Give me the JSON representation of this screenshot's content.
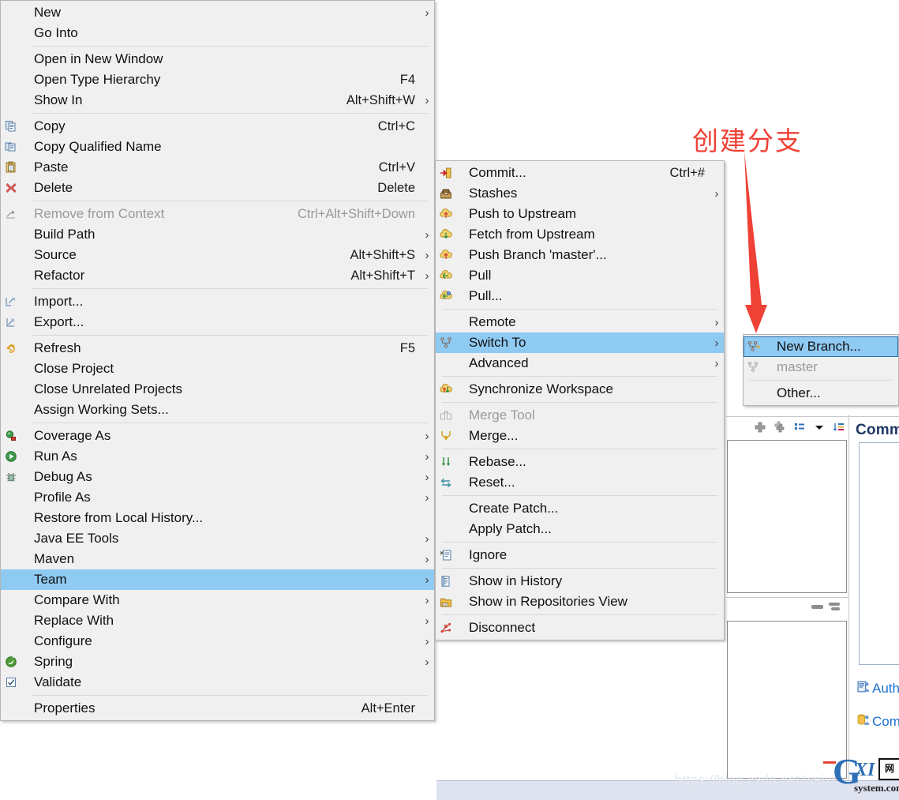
{
  "annotation": {
    "text": "创建分支",
    "color": "#ef4136",
    "arrow": "down-arrow"
  },
  "watermark": {
    "url": "https://blog.csdn.net/weixi",
    "logo_main": "G",
    "logo_xi": "XI",
    "logo_cn": "网",
    "logo_sub": "system.com"
  },
  "ide": {
    "commit_section_title": "Comm",
    "meta": [
      {
        "icon": "author-icon",
        "label": "Auth"
      },
      {
        "icon": "committer-icon",
        "label": "Com"
      }
    ],
    "toolbar_icons": [
      "add-icon",
      "add-all-icon",
      "list-view-icon",
      "chevron-down-icon",
      "sort-icon"
    ]
  },
  "colors": {
    "menu_bg": "#f0f0f0",
    "menu_border": "#b4b4b4",
    "highlight": "#8fcaf3",
    "highlight_border": "#2a6fa8",
    "separator": "#d8d8d8",
    "disabled_text": "#9a9a9a",
    "accent_red": "#ef4136",
    "link_blue": "#1d6fd0"
  },
  "context_menu": {
    "name": "project-context-menu",
    "items": [
      {
        "label": "New",
        "accel": "",
        "submenu": true,
        "icon": "",
        "type": "item"
      },
      {
        "label": "Go Into",
        "accel": "",
        "submenu": false,
        "icon": "",
        "type": "item"
      },
      {
        "type": "separator"
      },
      {
        "label": "Open in New Window",
        "accel": "",
        "submenu": false,
        "icon": "",
        "type": "item"
      },
      {
        "label": "Open Type Hierarchy",
        "accel": "F4",
        "submenu": false,
        "icon": "",
        "type": "item"
      },
      {
        "label": "Show In",
        "accel": "Alt+Shift+W",
        "submenu": true,
        "icon": "",
        "type": "item"
      },
      {
        "type": "separator"
      },
      {
        "label": "Copy",
        "accel": "Ctrl+C",
        "submenu": false,
        "icon": "copy-icon",
        "type": "item"
      },
      {
        "label": "Copy Qualified Name",
        "accel": "",
        "submenu": false,
        "icon": "copy-qualified-icon",
        "type": "item"
      },
      {
        "label": "Paste",
        "accel": "Ctrl+V",
        "submenu": false,
        "icon": "paste-icon",
        "type": "item"
      },
      {
        "label": "Delete",
        "accel": "Delete",
        "submenu": false,
        "icon": "delete-icon",
        "type": "item"
      },
      {
        "type": "separator"
      },
      {
        "label": "Remove from Context",
        "accel": "Ctrl+Alt+Shift+Down",
        "submenu": false,
        "icon": "remove-context-icon",
        "type": "item",
        "disabled": true
      },
      {
        "label": "Build Path",
        "accel": "",
        "submenu": true,
        "icon": "",
        "type": "item"
      },
      {
        "label": "Source",
        "accel": "Alt+Shift+S",
        "submenu": true,
        "icon": "",
        "type": "item"
      },
      {
        "label": "Refactor",
        "accel": "Alt+Shift+T",
        "submenu": true,
        "icon": "",
        "type": "item"
      },
      {
        "type": "separator"
      },
      {
        "label": "Import...",
        "accel": "",
        "submenu": false,
        "icon": "import-icon",
        "type": "item"
      },
      {
        "label": "Export...",
        "accel": "",
        "submenu": false,
        "icon": "export-icon",
        "type": "item"
      },
      {
        "type": "separator"
      },
      {
        "label": "Refresh",
        "accel": "F5",
        "submenu": false,
        "icon": "refresh-icon",
        "type": "item"
      },
      {
        "label": "Close Project",
        "accel": "",
        "submenu": false,
        "icon": "",
        "type": "item"
      },
      {
        "label": "Close Unrelated Projects",
        "accel": "",
        "submenu": false,
        "icon": "",
        "type": "item"
      },
      {
        "label": "Assign Working Sets...",
        "accel": "",
        "submenu": false,
        "icon": "",
        "type": "item"
      },
      {
        "type": "separator"
      },
      {
        "label": "Coverage As",
        "accel": "",
        "submenu": true,
        "icon": "coverage-icon",
        "type": "item"
      },
      {
        "label": "Run As",
        "accel": "",
        "submenu": true,
        "icon": "run-icon",
        "type": "item"
      },
      {
        "label": "Debug As",
        "accel": "",
        "submenu": true,
        "icon": "debug-icon",
        "type": "item"
      },
      {
        "label": "Profile As",
        "accel": "",
        "submenu": true,
        "icon": "",
        "type": "item"
      },
      {
        "label": "Restore from Local History...",
        "accel": "",
        "submenu": false,
        "icon": "",
        "type": "item"
      },
      {
        "label": "Java EE Tools",
        "accel": "",
        "submenu": true,
        "icon": "",
        "type": "item"
      },
      {
        "label": "Maven",
        "accel": "",
        "submenu": true,
        "icon": "",
        "type": "item"
      },
      {
        "label": "Team",
        "accel": "",
        "submenu": true,
        "icon": "",
        "type": "item",
        "selected": true
      },
      {
        "label": "Compare With",
        "accel": "",
        "submenu": true,
        "icon": "",
        "type": "item"
      },
      {
        "label": "Replace With",
        "accel": "",
        "submenu": true,
        "icon": "",
        "type": "item"
      },
      {
        "label": "Configure",
        "accel": "",
        "submenu": true,
        "icon": "",
        "type": "item"
      },
      {
        "label": "Spring",
        "accel": "",
        "submenu": true,
        "icon": "spring-icon",
        "type": "item"
      },
      {
        "label": "Validate",
        "accel": "",
        "submenu": false,
        "icon": "checkbox-icon",
        "type": "item"
      },
      {
        "type": "separator"
      },
      {
        "label": "Properties",
        "accel": "Alt+Enter",
        "submenu": false,
        "icon": "",
        "type": "item"
      }
    ]
  },
  "team_menu": {
    "name": "team-submenu",
    "items": [
      {
        "label": "Commit...",
        "accel": "Ctrl+#",
        "submenu": false,
        "icon": "commit-icon",
        "type": "item"
      },
      {
        "label": "Stashes",
        "accel": "",
        "submenu": true,
        "icon": "stash-icon",
        "type": "item"
      },
      {
        "label": "Push to Upstream",
        "accel": "",
        "submenu": false,
        "icon": "push-icon",
        "type": "item"
      },
      {
        "label": "Fetch from Upstream",
        "accel": "",
        "submenu": false,
        "icon": "fetch-icon",
        "type": "item"
      },
      {
        "label": "Push Branch 'master'...",
        "accel": "",
        "submenu": false,
        "icon": "push-branch-icon",
        "type": "item"
      },
      {
        "label": "Pull",
        "accel": "",
        "submenu": false,
        "icon": "pull-icon",
        "type": "item"
      },
      {
        "label": "Pull...",
        "accel": "",
        "submenu": false,
        "icon": "pull-config-icon",
        "type": "item"
      },
      {
        "type": "separator"
      },
      {
        "label": "Remote",
        "accel": "",
        "submenu": true,
        "icon": "",
        "type": "item"
      },
      {
        "label": "Switch To",
        "accel": "",
        "submenu": true,
        "icon": "switch-to-icon",
        "type": "item",
        "selected": true
      },
      {
        "label": "Advanced",
        "accel": "",
        "submenu": true,
        "icon": "",
        "type": "item"
      },
      {
        "type": "separator"
      },
      {
        "label": "Synchronize Workspace",
        "accel": "",
        "submenu": false,
        "icon": "synchronize-icon",
        "type": "item"
      },
      {
        "type": "separator"
      },
      {
        "label": "Merge Tool",
        "accel": "",
        "submenu": false,
        "icon": "merge-tool-icon",
        "type": "item",
        "disabled": true
      },
      {
        "label": "Merge...",
        "accel": "",
        "submenu": false,
        "icon": "merge-icon",
        "type": "item"
      },
      {
        "type": "separator"
      },
      {
        "label": "Rebase...",
        "accel": "",
        "submenu": false,
        "icon": "rebase-icon",
        "type": "item"
      },
      {
        "label": "Reset...",
        "accel": "",
        "submenu": false,
        "icon": "reset-icon",
        "type": "item"
      },
      {
        "type": "separator"
      },
      {
        "label": "Create Patch...",
        "accel": "",
        "submenu": false,
        "icon": "",
        "type": "item"
      },
      {
        "label": "Apply Patch...",
        "accel": "",
        "submenu": false,
        "icon": "",
        "type": "item"
      },
      {
        "type": "separator"
      },
      {
        "label": "Ignore",
        "accel": "",
        "submenu": false,
        "icon": "ignore-icon",
        "type": "item"
      },
      {
        "type": "separator"
      },
      {
        "label": "Show in History",
        "accel": "",
        "submenu": false,
        "icon": "history-icon",
        "type": "item"
      },
      {
        "label": "Show in Repositories View",
        "accel": "",
        "submenu": false,
        "icon": "repositories-icon",
        "type": "item"
      },
      {
        "type": "separator"
      },
      {
        "label": "Disconnect",
        "accel": "",
        "submenu": false,
        "icon": "disconnect-icon",
        "type": "item"
      }
    ]
  },
  "switch_to_menu": {
    "name": "switch-to-submenu",
    "items": [
      {
        "label": "New Branch...",
        "accel": "",
        "submenu": false,
        "icon": "new-branch-icon",
        "type": "item",
        "selected": true
      },
      {
        "label": "master",
        "accel": "",
        "submenu": false,
        "icon": "branch-icon",
        "type": "item",
        "disabled": true
      },
      {
        "type": "separator"
      },
      {
        "label": "Other...",
        "accel": "",
        "submenu": false,
        "icon": "",
        "type": "item"
      }
    ]
  }
}
